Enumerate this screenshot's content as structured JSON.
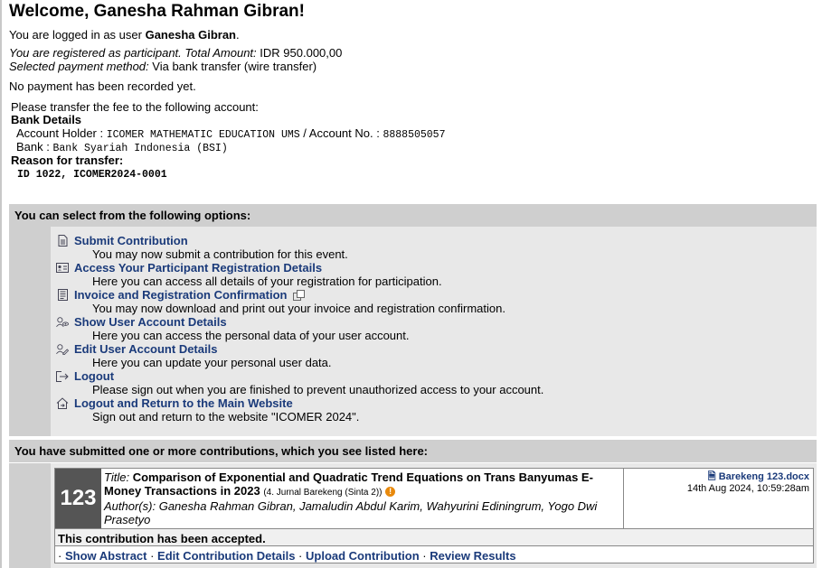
{
  "welcome": {
    "title": "Welcome, Ganesha Rahman Gibran!"
  },
  "login": {
    "prefix": "You are logged in as user ",
    "user": "Ganesha Gibran",
    "suffix": "."
  },
  "registration": {
    "status_text": "You are registered as participant. Total Amount:",
    "amount": "IDR 950.000,00",
    "method_label": "Selected payment method:",
    "method": "Via bank transfer (wire transfer)",
    "payment_status": "No payment has been recorded yet."
  },
  "bank": {
    "intro": "Please transfer the fee to the following account:",
    "details_label": "Bank Details",
    "holder_label": "Account Holder :",
    "holder_value": "ICOMER MATHEMATIC EDUCATION UMS",
    "account_label": "/ Account No. :",
    "account_value": "8888505057",
    "bank_label": "Bank :",
    "bank_value": "Bank Syariah Indonesia (BSI)",
    "reason_label": "Reason for transfer:",
    "reason_value": "ID 1022, ICOMER2024-0001"
  },
  "options": {
    "header": "You can select from the following options:",
    "items": [
      {
        "label": "Submit Contribution",
        "desc": "You may now submit a contribution for this event.",
        "icon": "document-icon"
      },
      {
        "label": "Access Your Participant Registration Details",
        "desc": "Here you can access all details of your registration for participation.",
        "icon": "id-card-icon"
      },
      {
        "label": "Invoice and Registration Confirmation",
        "desc": "You may now download and print out your invoice and registration confirmation.",
        "icon": "invoice-icon"
      },
      {
        "label": "Show User Account Details",
        "desc": "Here you can access the personal data of your user account.",
        "icon": "user-view-icon"
      },
      {
        "label": "Edit User Account Details",
        "desc": "Here you can update your personal user data.",
        "icon": "user-edit-icon"
      },
      {
        "label": "Logout",
        "desc": "Please sign out when you are finished to prevent unauthorized access to your account.",
        "icon": "logout-icon"
      },
      {
        "label": "Logout and Return to the Main Website",
        "desc": "Sign out and return to the website \"ICOMER 2024\".",
        "icon": "home-logout-icon"
      }
    ]
  },
  "contributions": {
    "header": "You have submitted one or more contributions, which you see listed here:",
    "items": [
      {
        "number": "123",
        "title_label": "Title:",
        "title": "Comparison of Exponential and Quadratic Trend Equations on Trans Banyumas E-Money Transactions in 2023",
        "track": "(4. Jurnal Barekeng (Sinta 2))",
        "authors_label": "Author(s):",
        "authors": "Ganesha Rahman Gibran, Jamaludin Abdul Karim, Wahyurini Ediningrum, Yogo Dwi Prasetyo",
        "file_name": "Barekeng 123.docx",
        "file_date": "14th Aug 2024, 10:59:28am",
        "status": "This contribution has been accepted.",
        "actions": [
          "Show Abstract",
          "Edit Contribution Details",
          "Upload Contribution",
          "Review Results"
        ]
      }
    ]
  }
}
